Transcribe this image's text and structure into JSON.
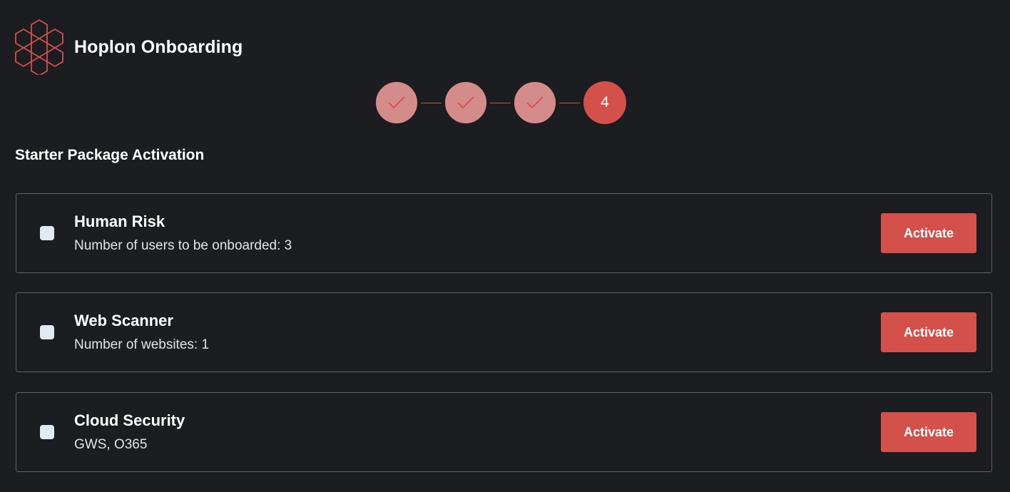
{
  "header": {
    "logo_icon": "hexagon-cluster-logo-icon",
    "title": "Hoplon Onboarding"
  },
  "stepper": {
    "steps": [
      {
        "state": "completed",
        "icon": "check-icon"
      },
      {
        "state": "completed",
        "icon": "check-icon"
      },
      {
        "state": "completed",
        "icon": "check-icon"
      },
      {
        "state": "current",
        "label": "4"
      }
    ]
  },
  "section": {
    "title": "Starter Package Activation"
  },
  "packages": [
    {
      "name": "Human Risk",
      "description": "Number of users to be onboarded: 3",
      "button_label": "Activate"
    },
    {
      "name": "Web Scanner",
      "description": "Number of websites: 1",
      "button_label": "Activate"
    },
    {
      "name": "Cloud Security",
      "description": "GWS, O365",
      "button_label": "Activate"
    }
  ],
  "colors": {
    "background": "#1b1d21",
    "accent": "#d3504b",
    "step_done": "#d48c8b",
    "card_border": "#5f6167",
    "checkbox": "#e1e9f1"
  }
}
